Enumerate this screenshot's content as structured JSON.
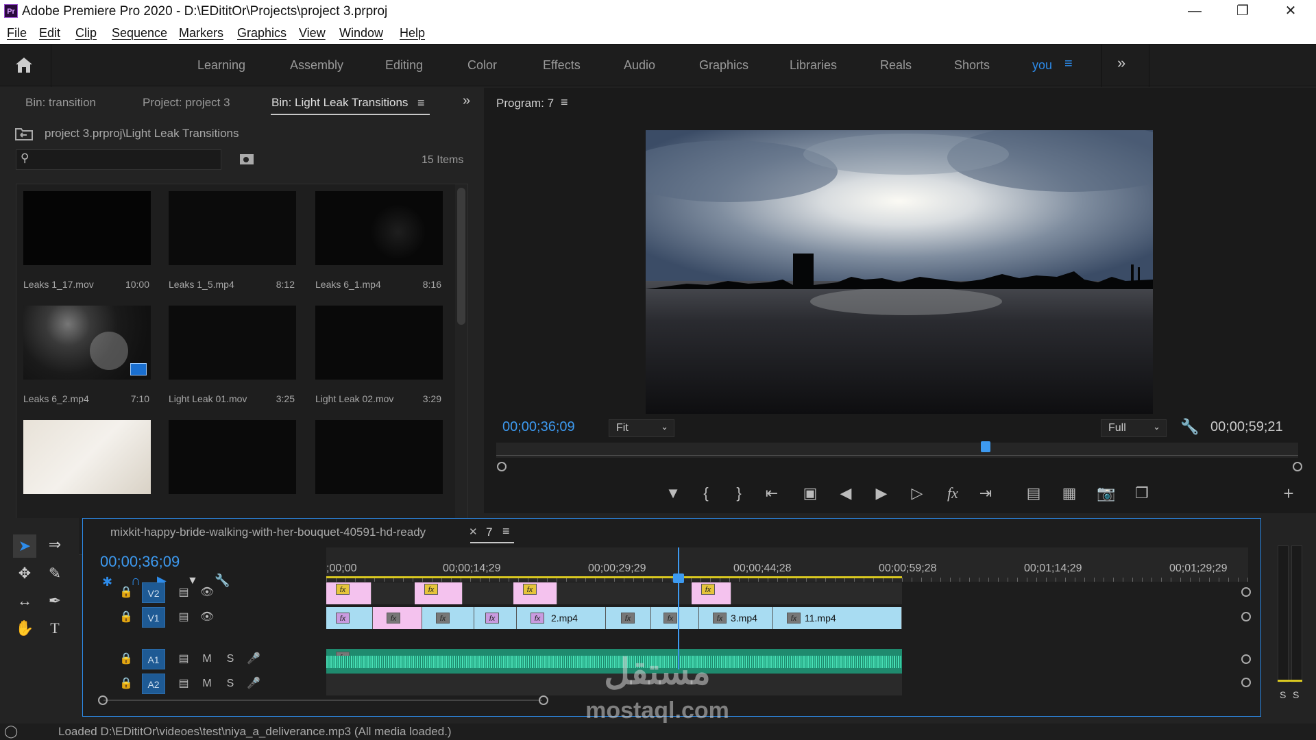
{
  "app": {
    "title": "Adobe Premiere Pro 2020 - D:\\EDititOr\\Projects\\project 3.prproj",
    "icon_text": "Pr"
  },
  "menu": [
    "File",
    "Edit",
    "Clip",
    "Sequence",
    "Markers",
    "Graphics",
    "View",
    "Window",
    "Help"
  ],
  "workspaces": [
    "Learning",
    "Assembly",
    "Editing",
    "Color",
    "Effects",
    "Audio",
    "Graphics",
    "Libraries",
    "Reals",
    "Shorts",
    "you"
  ],
  "active_workspace": "you",
  "project_panel": {
    "tabs": [
      "Bin: transition",
      "Project: project 3",
      "Bin: Light Leak Transitions"
    ],
    "path": "project 3.prproj\\Light Leak Transitions",
    "items_count": "15 Items",
    "items": [
      {
        "name": "Leaks 1_17.mov",
        "duration": "10:00"
      },
      {
        "name": "Leaks 1_5.mp4",
        "duration": "8:12"
      },
      {
        "name": "Leaks 6_1.mp4",
        "duration": "8:16"
      },
      {
        "name": "Leaks 6_2.mp4",
        "duration": "7:10"
      },
      {
        "name": "Light Leak 01.mov",
        "duration": "3:25"
      },
      {
        "name": "Light Leak 02.mov",
        "duration": "3:29"
      }
    ]
  },
  "program_monitor": {
    "title": "Program: 7",
    "timecode_current": "00;00;36;09",
    "fit": "Fit",
    "resolution": "Full",
    "timecode_duration": "00;00;59;21",
    "playhead_fraction": 0.61
  },
  "timeline": {
    "tab_inactive": "mixkit-happy-bride-walking-with-her-bouquet-40591-hd-ready",
    "tab_active": "7",
    "timecode": "00;00;36;09",
    "ruler_labels": [
      ";00;00",
      "00;00;14;29",
      "00;00;29;29",
      "00;00;44;28",
      "00;00;59;28",
      "00;01;14;29",
      "00;01;29;29"
    ],
    "tracks": {
      "video": [
        "V2",
        "V1"
      ],
      "audio": [
        "A1",
        "A2"
      ]
    },
    "clip_labels": {
      "c1": "2.mp4",
      "c2": "3.mp4",
      "c3": "11.mp4"
    },
    "fx": "fx",
    "audio_toggles": {
      "mute": "M",
      "solo": "S"
    }
  },
  "meters": {
    "solo_left": "S",
    "solo_right": "S"
  },
  "status": "Loaded D:\\EDititOr\\videoes\\test\\niya_a_deliverance.mp3 (All media loaded.)",
  "watermark": {
    "text": "mostaql.com",
    "arabic": "مستقل"
  },
  "colors": {
    "accent": "#2d8ceb",
    "audio_clip": "#1f8a6e",
    "video_clip": "#a8dcf2",
    "adjustment_clip": "#f4c2ee",
    "work_area": "#d9c820"
  }
}
